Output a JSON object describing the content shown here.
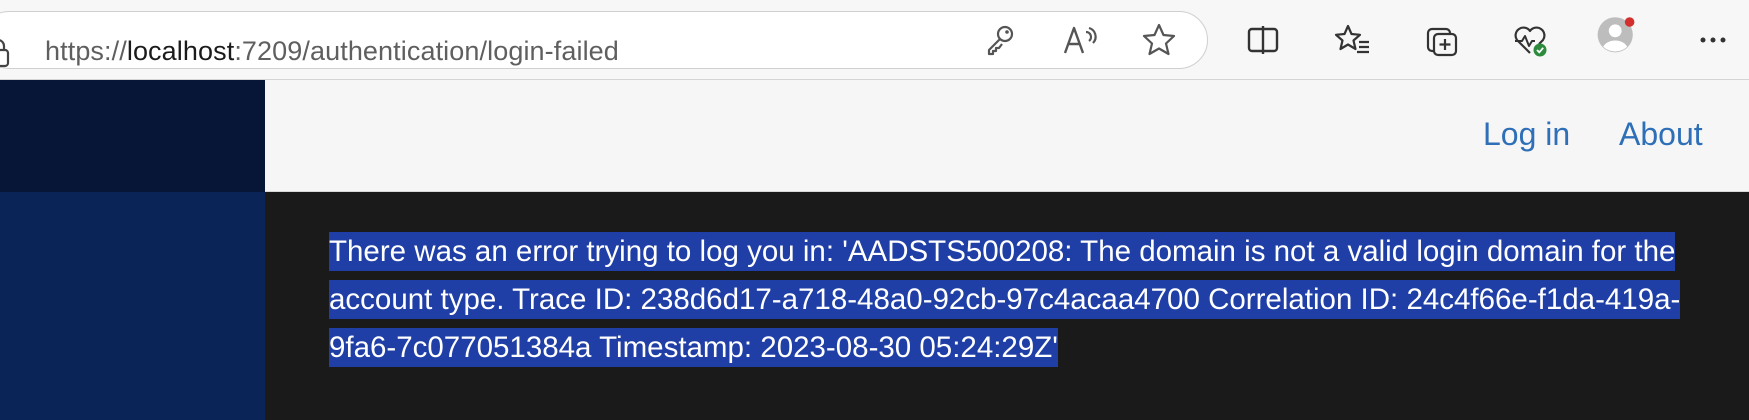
{
  "browser": {
    "url_scheme": "https://",
    "url_host": "localhost",
    "url_rest": ":7209/authentication/login-failed",
    "icons": [
      "lock-icon",
      "key-icon",
      "read-aloud-icon",
      "favorite-star-icon",
      "split-screen-icon",
      "favorites-icon",
      "collections-icon",
      "browser-essentials-icon",
      "profile-avatar-icon",
      "more-options-icon"
    ]
  },
  "nav": {
    "login_label": "Log in",
    "about_label": "About"
  },
  "main": {
    "error_message": "There was an error trying to log you in: 'AADSTS500208: The domain is not a valid login domain for the account type. Trace ID: 238d6d17-a718-48a0-92cb-97c4acaa4700 Correlation ID: 24c4f66e-f1da-419a-9fa6-7c077051384a Timestamp: 2023-08-30 05:24:29Z'"
  },
  "colors": {
    "sidebar_top": "#071536",
    "sidebar_bottom": "#0b2457",
    "nav_link": "#2e6fb7",
    "selection": "#1f3fa6",
    "content_bg": "#1a1a1a",
    "notification_dot": "#d32f2f"
  }
}
